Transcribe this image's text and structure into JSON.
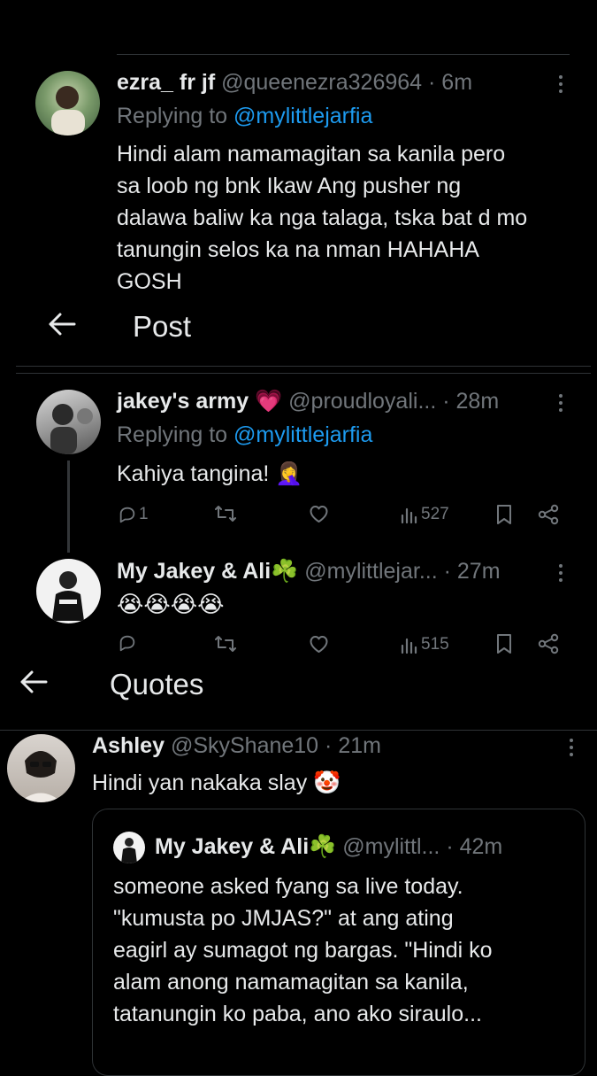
{
  "reply1": {
    "name": "ezra_ fr jf",
    "handle": "@queenezra326964",
    "time": "· 6m",
    "replying_prefix": "Replying to",
    "replying_to": "@mylittlejarfia",
    "lines": [
      "Hindi alam namamagitan sa kanila pero",
      "sa loob ng bnk Ikaw Ang pusher ng",
      "dalawa baliw ka nga talaga, tska bat d mo",
      "tanungin selos ka na nman HAHAHA",
      "GOSH"
    ]
  },
  "header_post": {
    "title": "Post"
  },
  "reply2": {
    "name": "jakey's army 💗",
    "handle": "@proudloyali...",
    "time": "· 28m",
    "replying_prefix": "Replying to",
    "replying_to": "@mylittlejarfia",
    "text": "Kahiya tangina! 🤦‍♀️",
    "replies": "1",
    "views": "527"
  },
  "reply3": {
    "name": "My Jakey & Ali☘️",
    "handle": "@mylittlejar...",
    "time": "· 27m",
    "text": "😭😭😭😭",
    "views": "515"
  },
  "header_quotes": {
    "title": "Quotes"
  },
  "quote": {
    "name": "Ashley",
    "handle": "@SkyShane10",
    "time": "· 21m",
    "text": "Hindi yan nakaka slay 🤡",
    "embedded": {
      "name": "My Jakey & Ali☘️",
      "handle": "@mylittl...",
      "time": "· 42m",
      "lines": [
        "someone asked fyang sa live today.",
        "\"kumusta po JMJAS?\" at ang ating",
        "eagirl ay sumagot ng bargas. \"Hindi ko",
        "alam anong namamagitan sa kanila,",
        "tatanungin ko paba, ano ako siraulo..."
      ]
    }
  },
  "colors": {
    "background": "#000000",
    "text": "#e7e9ea",
    "muted": "#71767b",
    "link": "#1d9bf0",
    "divider": "#2f3336"
  }
}
